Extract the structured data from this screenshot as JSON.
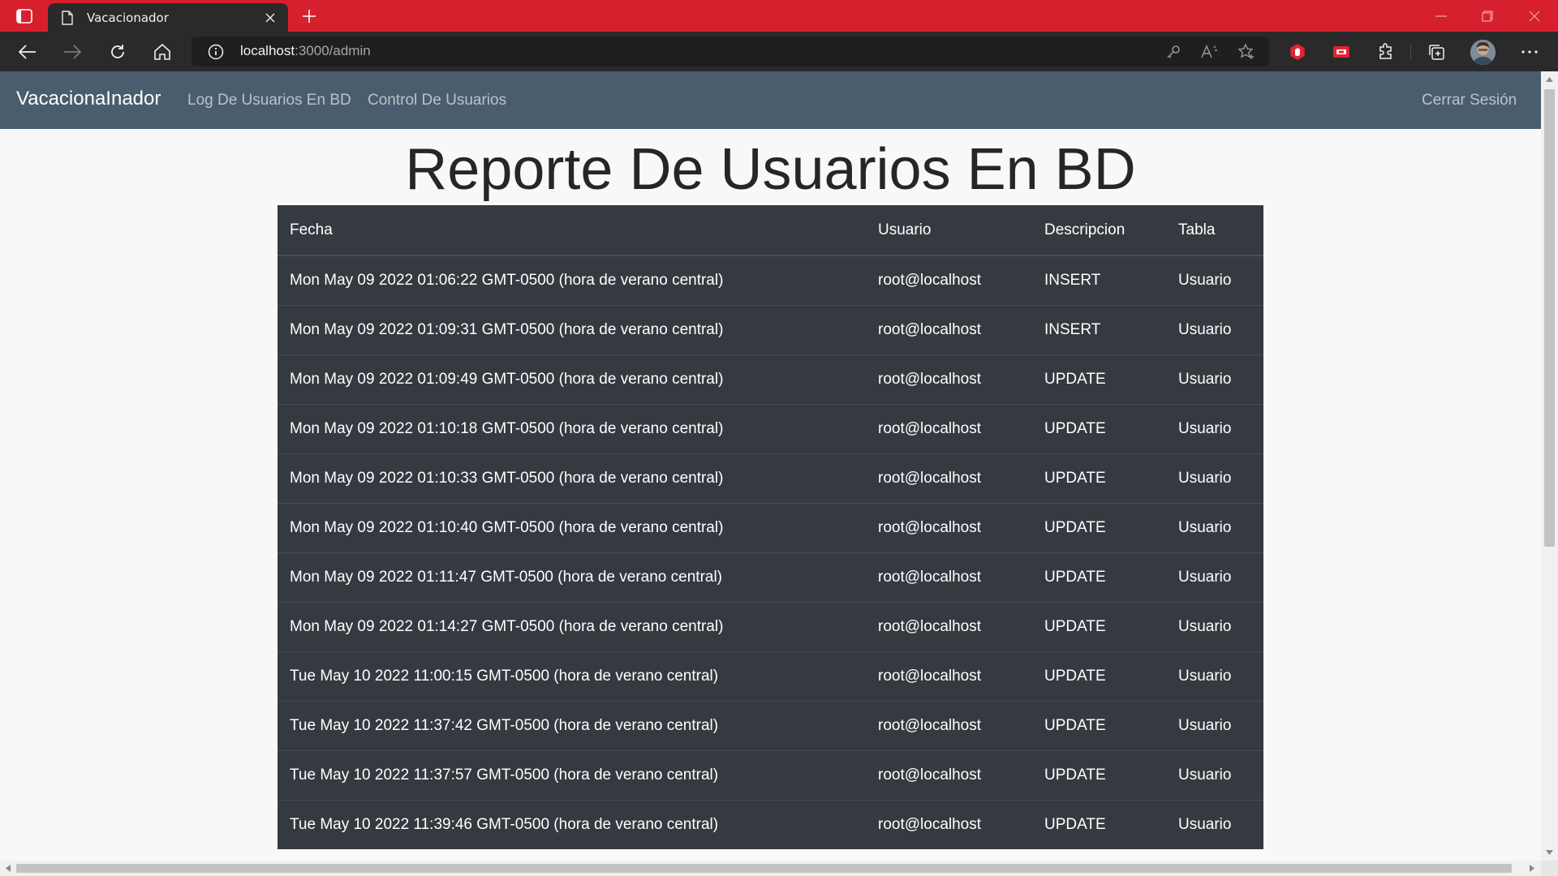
{
  "browser": {
    "tab_title": "Vacacionador",
    "url_host": "localhost",
    "url_rest": ":3000/admin",
    "icons": {
      "sidebar": "tab-actions-icon",
      "page": "page-icon",
      "close": "close-icon",
      "new_tab": "plus-icon",
      "back": "back-arrow-icon",
      "forward": "forward-arrow-icon",
      "refresh": "refresh-icon",
      "home": "home-icon",
      "info": "info-icon",
      "key": "key-icon",
      "read_aloud": "read-aloud-icon",
      "favorite": "favorite-star-icon",
      "extension1": "hand-extension-icon",
      "extension2": "extension-icon",
      "extensions": "puzzle-icon",
      "collections": "collections-icon",
      "menu": "more-menu-icon"
    },
    "accent_color": "#d7202e"
  },
  "navbar": {
    "brand": "VacacionaInador",
    "links": [
      {
        "label": "Log De Usuarios En BD"
      },
      {
        "label": "Control De Usuarios"
      }
    ],
    "logout": "Cerrar Sesión",
    "color": "#4a5d6e"
  },
  "page": {
    "title": "Reporte De Usuarios En BD"
  },
  "table": {
    "headers": [
      "Fecha",
      "Usuario",
      "Descripcion",
      "Tabla"
    ],
    "rows": [
      [
        "Mon May 09 2022 01:06:22 GMT-0500 (hora de verano central)",
        "root@localhost",
        "INSERT",
        "Usuario"
      ],
      [
        "Mon May 09 2022 01:09:31 GMT-0500 (hora de verano central)",
        "root@localhost",
        "INSERT",
        "Usuario"
      ],
      [
        "Mon May 09 2022 01:09:49 GMT-0500 (hora de verano central)",
        "root@localhost",
        "UPDATE",
        "Usuario"
      ],
      [
        "Mon May 09 2022 01:10:18 GMT-0500 (hora de verano central)",
        "root@localhost",
        "UPDATE",
        "Usuario"
      ],
      [
        "Mon May 09 2022 01:10:33 GMT-0500 (hora de verano central)",
        "root@localhost",
        "UPDATE",
        "Usuario"
      ],
      [
        "Mon May 09 2022 01:10:40 GMT-0500 (hora de verano central)",
        "root@localhost",
        "UPDATE",
        "Usuario"
      ],
      [
        "Mon May 09 2022 01:11:47 GMT-0500 (hora de verano central)",
        "root@localhost",
        "UPDATE",
        "Usuario"
      ],
      [
        "Mon May 09 2022 01:14:27 GMT-0500 (hora de verano central)",
        "root@localhost",
        "UPDATE",
        "Usuario"
      ],
      [
        "Tue May 10 2022 11:00:15 GMT-0500 (hora de verano central)",
        "root@localhost",
        "UPDATE",
        "Usuario"
      ],
      [
        "Tue May 10 2022 11:37:42 GMT-0500 (hora de verano central)",
        "root@localhost",
        "UPDATE",
        "Usuario"
      ],
      [
        "Tue May 10 2022 11:37:57 GMT-0500 (hora de verano central)",
        "root@localhost",
        "UPDATE",
        "Usuario"
      ],
      [
        "Tue May 10 2022 11:39:46 GMT-0500 (hora de verano central)",
        "root@localhost",
        "UPDATE",
        "Usuario"
      ]
    ]
  }
}
